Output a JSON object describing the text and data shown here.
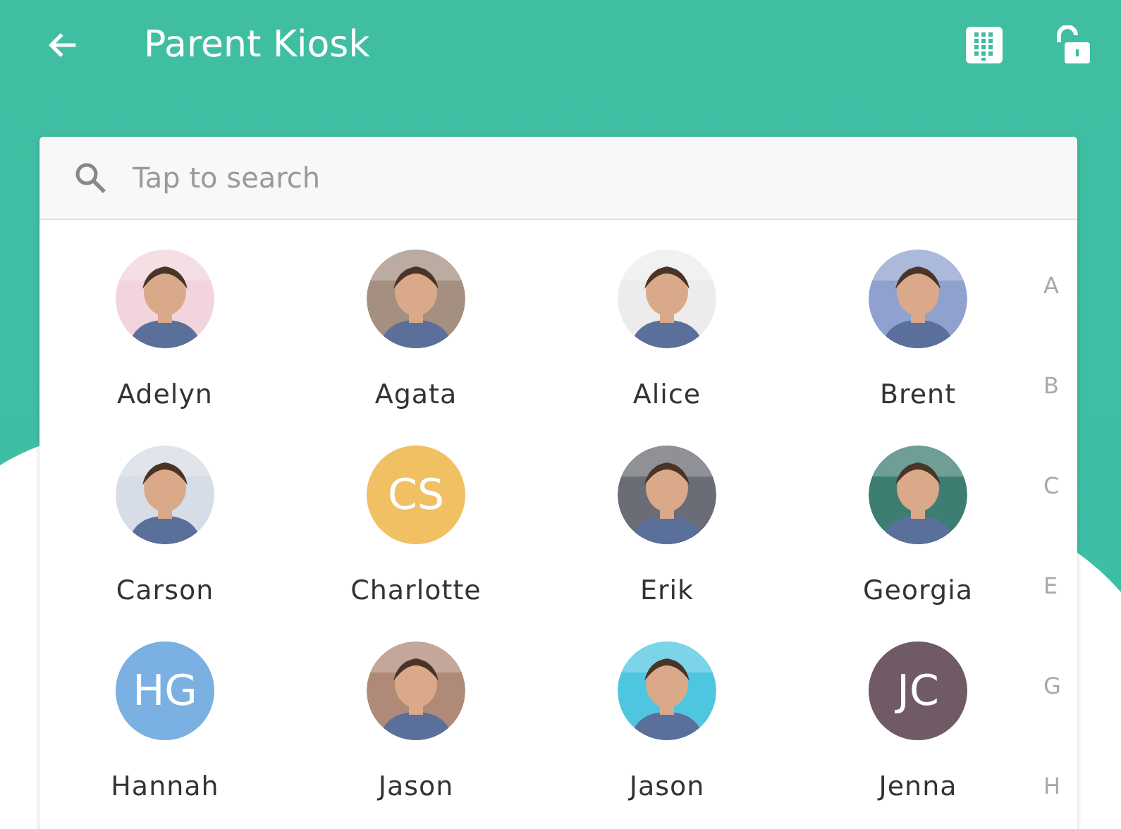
{
  "header": {
    "title": "Parent Kiosk"
  },
  "search": {
    "placeholder": "Tap to search"
  },
  "people": [
    {
      "name": "Adelyn",
      "kind": "picture"
    },
    {
      "name": "Agata",
      "kind": "picture"
    },
    {
      "name": "Alice",
      "kind": "picture"
    },
    {
      "name": "Brent",
      "kind": "picture"
    },
    {
      "name": "Carson",
      "kind": "picture"
    },
    {
      "name": "Charlotte",
      "kind": "initials",
      "initials": "CS",
      "color": "#f0c063"
    },
    {
      "name": "Erik",
      "kind": "picture"
    },
    {
      "name": "Georgia",
      "kind": "picture"
    },
    {
      "name": "Hannah",
      "kind": "initials",
      "initials": "HG",
      "color": "#7ab0e2"
    },
    {
      "name": "Jason",
      "kind": "picture"
    },
    {
      "name": "Jason",
      "kind": "picture"
    },
    {
      "name": "Jenna",
      "kind": "initials",
      "initials": "JC",
      "color": "#6f5a66"
    }
  ],
  "index": [
    "A",
    "B",
    "C",
    "E",
    "G",
    "H"
  ]
}
